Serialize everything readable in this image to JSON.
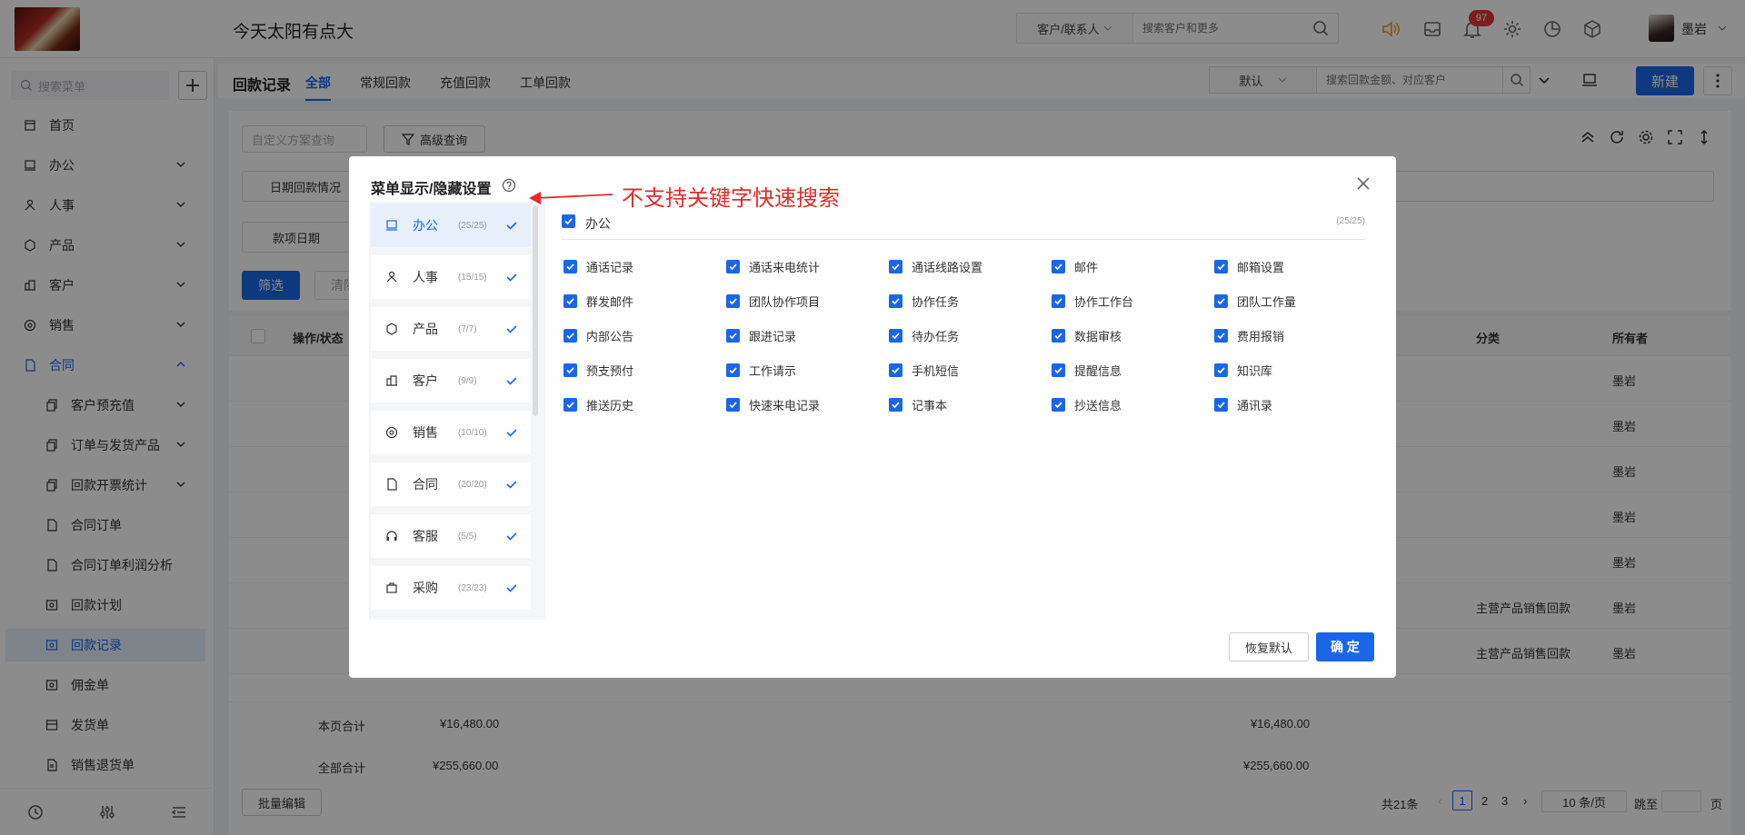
{
  "header": {
    "company": "今天太阳有点大",
    "search_scope": "客户/联系人",
    "search_placeholder": "搜索客户和更多",
    "badge_count": "97",
    "username": "墨岩"
  },
  "sidebar": {
    "search_placeholder": "搜索菜单",
    "items": [
      {
        "label": "首页"
      },
      {
        "label": "办公"
      },
      {
        "label": "人事"
      },
      {
        "label": "产品"
      },
      {
        "label": "客户"
      },
      {
        "label": "销售"
      },
      {
        "label": "合同"
      },
      {
        "label": "客户预充值"
      },
      {
        "label": "订单与发货产品"
      },
      {
        "label": "回款开票统计"
      },
      {
        "label": "合同订单"
      },
      {
        "label": "合同订单利润分析"
      },
      {
        "label": "回款计划"
      },
      {
        "label": "回款记录"
      },
      {
        "label": "佣金单"
      },
      {
        "label": "发货单"
      },
      {
        "label": "销售退货单"
      }
    ]
  },
  "page": {
    "title": "回款记录",
    "tabs": [
      "全部",
      "常规回款",
      "充值回款",
      "工单回款"
    ],
    "view": "默认",
    "search_placeholder": "搜索回款金额、对应客户",
    "new_label": "新建",
    "filter_placeholder": "自定义方案查询",
    "advanced_label": "高级查询",
    "filter_row1": "日期回款情况",
    "filter_row2": "款项日期",
    "btn_filter": "筛选",
    "btn_clear": "清除",
    "columns": [
      "操作/状态",
      "分类",
      "所有者"
    ],
    "rows": [
      {
        "category": "",
        "owner": "墨岩"
      },
      {
        "category": "",
        "owner": "墨岩"
      },
      {
        "category": "",
        "owner": "墨岩"
      },
      {
        "category": "",
        "owner": "墨岩"
      },
      {
        "category": "",
        "owner": "墨岩"
      },
      {
        "category": "主营产品销售回款",
        "owner": "墨岩"
      },
      {
        "category": "主营产品销售回款",
        "owner": "墨岩"
      }
    ],
    "page_total_label": "本页合计",
    "page_total": "¥16,480.00",
    "all_total_label": "全部合计",
    "all_total": "¥255,660.00",
    "batch_edit": "批量编辑",
    "pagination": {
      "total": "共21条",
      "pages": [
        "1",
        "2",
        "3"
      ],
      "size": "10 条/页",
      "goto": "跳至",
      "page_unit": "页"
    }
  },
  "modal": {
    "title": "菜单显示/隐藏设置",
    "categories": [
      {
        "name": "办公",
        "count": "(25/25)",
        "icon": "office-icon"
      },
      {
        "name": "人事",
        "count": "(15/15)",
        "icon": "hr-icon"
      },
      {
        "name": "产品",
        "count": "(7/7)",
        "icon": "product-icon"
      },
      {
        "name": "客户",
        "count": "(9/9)",
        "icon": "customer-icon"
      },
      {
        "name": "销售",
        "count": "(10/10)",
        "icon": "sales-icon"
      },
      {
        "name": "合同",
        "count": "(20/20)",
        "icon": "contract-icon"
      },
      {
        "name": "客服",
        "count": "(5/5)",
        "icon": "service-icon"
      },
      {
        "name": "采购",
        "count": "(23/23)",
        "icon": "purchase-icon"
      }
    ],
    "section": {
      "name": "办公",
      "count": "(25/25)"
    },
    "options": [
      "通话记录",
      "通话来电统计",
      "通话线路设置",
      "邮件",
      "邮箱设置",
      "群发邮件",
      "团队协作项目",
      "协作任务",
      "协作工作台",
      "团队工作量",
      "内部公告",
      "跟进记录",
      "待办任务",
      "数据审核",
      "费用报销",
      "预支预付",
      "工作请示",
      "手机短信",
      "提醒信息",
      "知识库",
      "推送历史",
      "快速来电记录",
      "记事本",
      "抄送信息",
      "通讯录"
    ],
    "reset_label": "恢复默认",
    "ok_label": "确 定"
  },
  "annotation": {
    "text": "不支持关键字快速搜索",
    "color": "#e42a2a"
  },
  "colors": {
    "primary": "#1a66e8",
    "badge": "#e5363a"
  }
}
